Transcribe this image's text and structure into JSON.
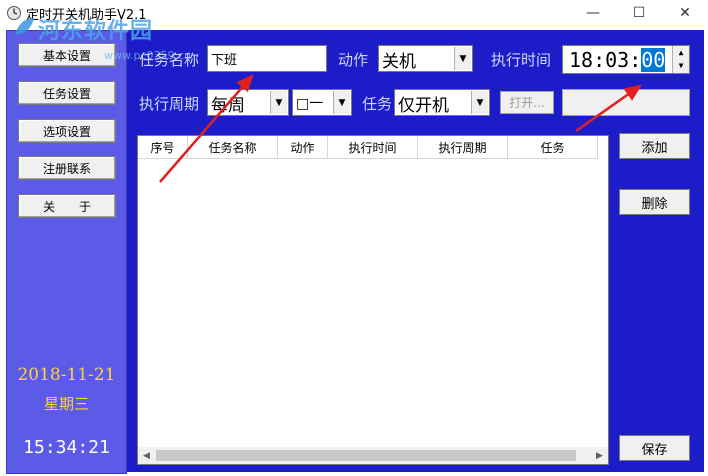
{
  "window": {
    "title": "定时开关机助手V2.1",
    "minimize_glyph": "—",
    "maximize_glyph": "☐",
    "close_glyph": "✕"
  },
  "watermark": {
    "main": "河东软件园",
    "sub": "www.pc0359.cn"
  },
  "sidebar": {
    "items": [
      {
        "label": "基本设置"
      },
      {
        "label": "任务设置"
      },
      {
        "label": "选项设置"
      },
      {
        "label": "注册联系"
      },
      {
        "label": "关　　于"
      }
    ],
    "date": "2018-11-21",
    "weekday": "星期三",
    "clock": "15:34:21"
  },
  "form": {
    "task_name_label": "任务名称",
    "task_name_value": "下班",
    "action_label": "动作",
    "action_value": "关机",
    "exec_time_label": "执行时间",
    "time_hm": "18:03:",
    "time_sec": "00",
    "period_label": "执行周期",
    "period_value": "每周",
    "day_value": "□一",
    "task_label": "任务",
    "task_value": "仅开机",
    "open_button": "打开...",
    "path_value": ""
  },
  "table": {
    "columns": [
      "序号",
      "任务名称",
      "动作",
      "执行时间",
      "执行周期",
      "任务"
    ],
    "rows": []
  },
  "actions": {
    "add": "添加",
    "delete": "删除",
    "save": "保存"
  },
  "colors": {
    "panel_blue": "#1c1cc8",
    "sidebar_blue": "#5b5be8",
    "date_yellow": "#ffd23a",
    "annotation_red": "#e02020"
  }
}
